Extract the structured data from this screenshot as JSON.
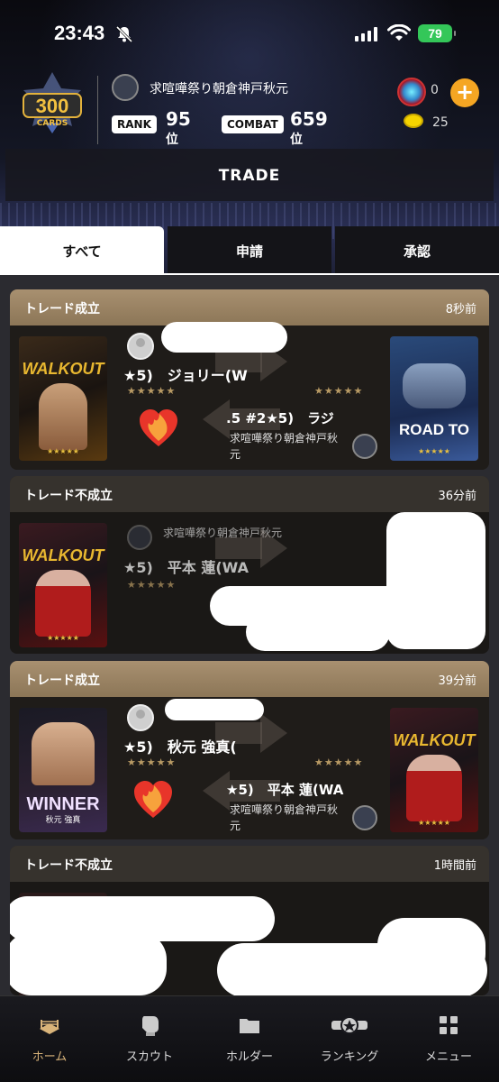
{
  "status_bar": {
    "time": "23:43",
    "battery": "79"
  },
  "header": {
    "badge_number": "300",
    "badge_label": "CARDS",
    "username": "求喧嘩祭り朝倉神戸秋元",
    "rank_label": "RANK",
    "rank_value": "95",
    "rank_unit": "位",
    "combat_label": "COMBAT",
    "combat_value": "659",
    "combat_unit": "位",
    "gem_count": "0",
    "coin_count": "25"
  },
  "page_title": "TRADE",
  "tabs": [
    {
      "label": "すべて",
      "active": true
    },
    {
      "label": "申請",
      "active": false
    },
    {
      "label": "承認",
      "active": false
    }
  ],
  "trades": [
    {
      "status": "トレード成立",
      "time": "8秒前",
      "left_card_title": "WALKOUT",
      "right_card_title": "ROAD TO",
      "partner_card": "★5)　ジョリー(W",
      "my_card": ".5 #2★5)　ラジ",
      "owner": "求喧嘩祭り朝倉神戸秋元"
    },
    {
      "status": "トレード不成立",
      "time": "36分前",
      "left_card_title": "WALKOUT",
      "owner": "求喧嘩祭り朝倉神戸秋元",
      "partner_card": "★5)　平本 蓮(WA"
    },
    {
      "status": "トレード成立",
      "time": "39分前",
      "left_card_title": "WINNER",
      "left_card_sub": "秋元 強真",
      "right_card_title": "WALKOUT",
      "partner_card": "★5)　秋元 強真(",
      "my_card": "★5)　平本 蓮(WA",
      "owner": "求喧嘩祭り朝倉神戸秋元"
    },
    {
      "status": "トレード不成立",
      "time": "1時間前"
    }
  ],
  "nav": [
    {
      "label": "ホーム",
      "icon": "ring-icon",
      "active": true
    },
    {
      "label": "スカウト",
      "icon": "glove-icon",
      "active": false
    },
    {
      "label": "ホルダー",
      "icon": "folder-icon",
      "active": false
    },
    {
      "label": "ランキング",
      "icon": "belt-icon",
      "active": false
    },
    {
      "label": "メニュー",
      "icon": "grid-icon",
      "active": false
    }
  ],
  "colors": {
    "accent": "#f5a623",
    "success_header": "#a89070",
    "fail_header": "#36322d",
    "battery": "#34c759",
    "nav_active": "#d9b47a"
  }
}
